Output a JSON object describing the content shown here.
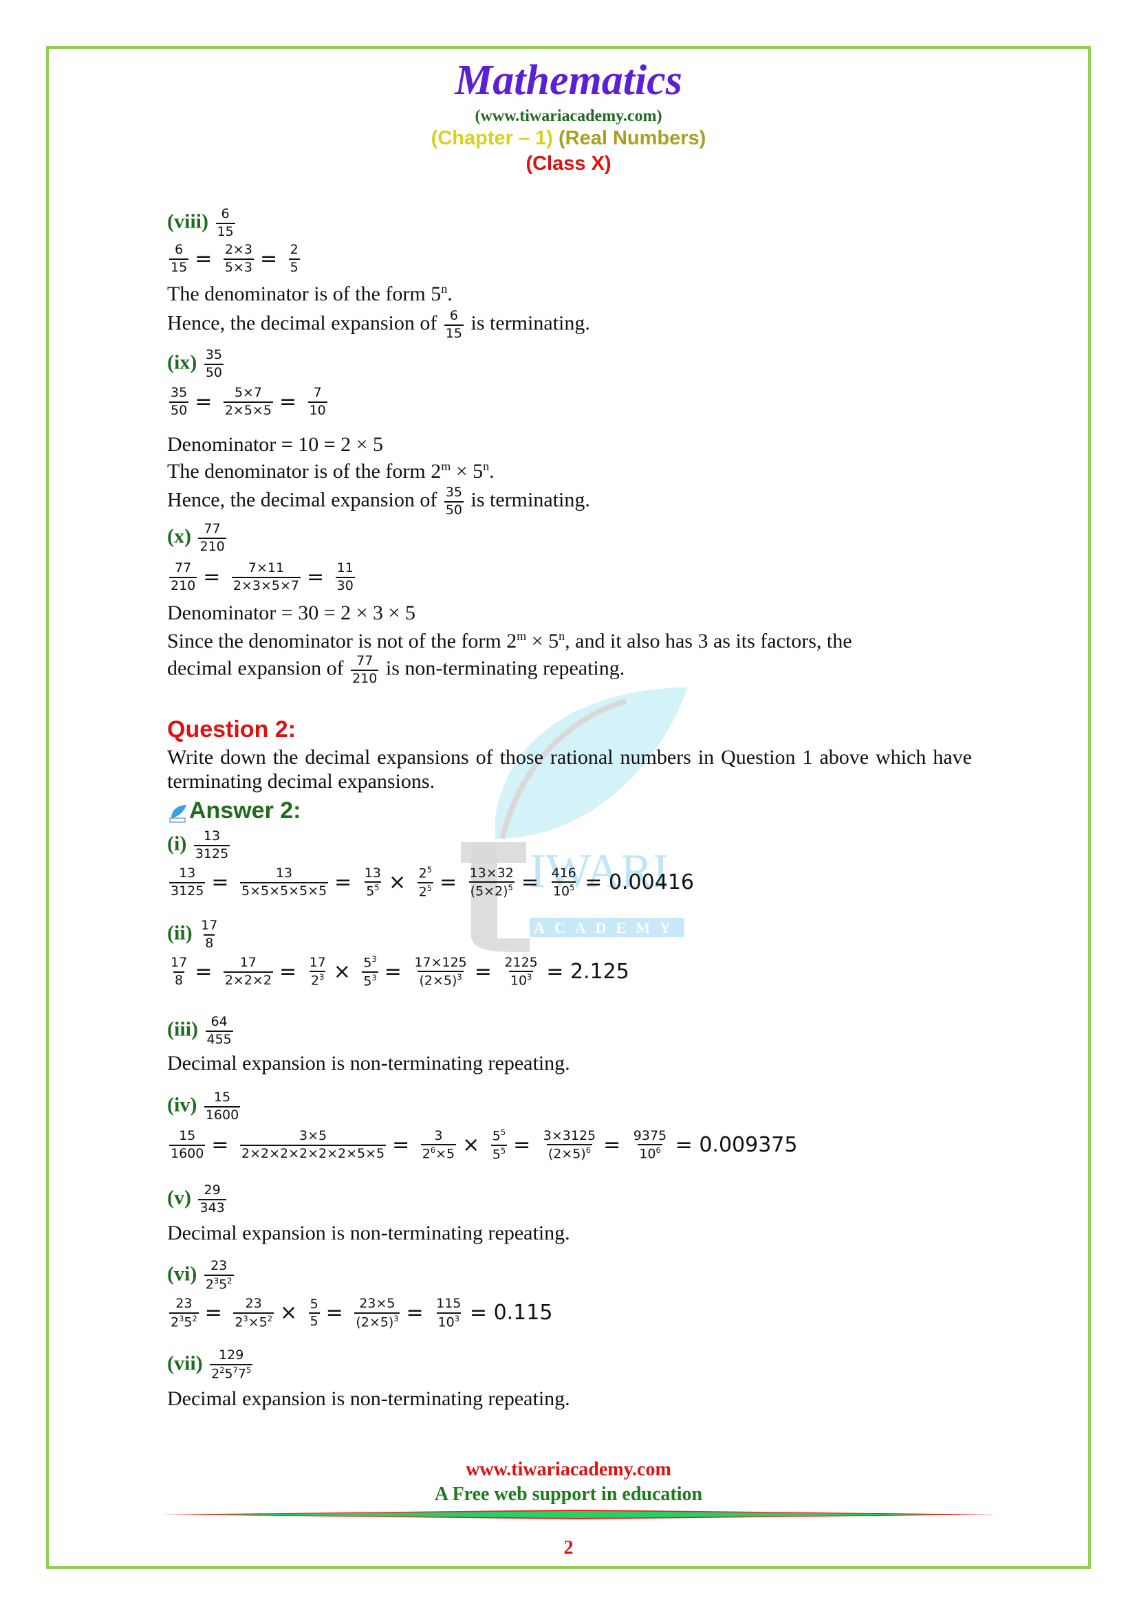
{
  "header": {
    "title": "Mathematics",
    "site": "(www.tiwariacademy.com)",
    "chapter_a": "(Chapter – 1)",
    "chapter_b": "(Real Numbers)",
    "class": "(Class X)"
  },
  "q1_parts": {
    "viii": {
      "label": "(viii)",
      "frac": {
        "num": "6",
        "den": "15"
      },
      "steps": [
        {
          "num": "6",
          "den": "15"
        },
        {
          "num": "2×3",
          "den": "5×3"
        },
        {
          "num": "2",
          "den": "5"
        }
      ],
      "line1_a": "The denominator is of the form 5",
      "line1_sup": "n",
      "line1_b": ".",
      "line2_a": "Hence, the decimal expansion of",
      "line2_b": "is terminating."
    },
    "ix": {
      "label": "(ix)",
      "frac": {
        "num": "35",
        "den": "50"
      },
      "steps": [
        {
          "num": "35",
          "den": "50"
        },
        {
          "num": "5×7",
          "den": "2×5×5"
        },
        {
          "num": "7",
          "den": "10"
        }
      ],
      "denominator_line": "Denominator =  10 = 2 × 5",
      "line1_a": "The denominator is of the form 2",
      "line1_sup_m": "m",
      "line1_mid": " × 5",
      "line1_sup_n": "n",
      "line1_b": ".",
      "line2_a": "Hence, the decimal expansion of",
      "line2_b": "is terminating."
    },
    "x": {
      "label": "(x)",
      "frac": {
        "num": "77",
        "den": "210"
      },
      "steps": [
        {
          "num": "77",
          "den": "210"
        },
        {
          "num": "7×11",
          "den": "2×3×5×7"
        },
        {
          "num": "11",
          "den": "30"
        }
      ],
      "denominator_line": "Denominator = 30 = 2 × 3 × 5",
      "line1_a": "Since the denominator is not of the form 2",
      "line1_sup_m": "m",
      "line1_mid": " × 5",
      "line1_sup_n": "n",
      "line1_b": ", and it also has 3 as its factors, the",
      "line2_a": "decimal expansion of",
      "line2_b": "is non-terminating repeating."
    }
  },
  "question2": {
    "title": "Question 2:",
    "text": "Write down the decimal expansions of those rational numbers in Question 1 above which have terminating decimal expansions."
  },
  "answer2": {
    "title": "Answer 2:",
    "logo_icon": "tiwari-leaf-logo-icon",
    "parts": {
      "i": {
        "label": "(i)",
        "frac": {
          "num": "13",
          "den": "3125"
        },
        "result": "= 0.00416"
      },
      "ii": {
        "label": "(ii)",
        "frac": {
          "num": "17",
          "den": "8"
        },
        "result": "= 2.125"
      },
      "iii": {
        "label": "(iii)",
        "frac": {
          "num": "64",
          "den": "455"
        },
        "text": "Decimal expansion is non-terminating repeating."
      },
      "iv": {
        "label": "(iv)",
        "frac": {
          "num": "15",
          "den": "1600"
        },
        "result": "= 0.009375"
      },
      "v": {
        "label": "(v)",
        "frac": {
          "num": "29",
          "den": "343"
        },
        "text": "Decimal expansion is non-terminating repeating."
      },
      "vi": {
        "label": "(vi)",
        "result": "= 0.115"
      },
      "vii": {
        "label": "(vii)",
        "num": "129",
        "text": "Decimal expansion is non-terminating repeating."
      }
    }
  },
  "watermark": {
    "word1": "IWARI",
    "word2": "ACADEMY"
  },
  "footer": {
    "site": "www.tiwariacademy.com",
    "tagline": "A Free web support in education",
    "page_number": "2"
  },
  "colors": {
    "frame": "#92d050",
    "title": "#5b1fd6",
    "label_green": "#1f6b1f",
    "question_red": "#e01010"
  }
}
